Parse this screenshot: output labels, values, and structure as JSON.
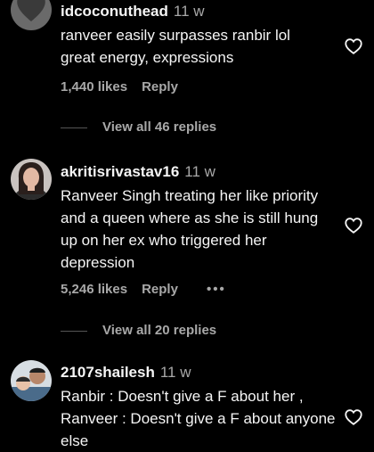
{
  "comments": [
    {
      "username": "idcoconuthead",
      "time": "11 w",
      "text": "ranveer easily surpasses ranbir lol great energy, expressions",
      "likes": "1,440 likes",
      "reply_label": "Reply",
      "view_replies": "View all 46 replies"
    },
    {
      "username": "akritisrivastav16",
      "time": "11 w",
      "text": "Ranveer Singh treating her like priority and a queen where as she is still hung up on her ex who triggered her depression",
      "likes": "5,246 likes",
      "reply_label": "Reply",
      "more_label": "•••",
      "view_replies": "View all 20 replies"
    },
    {
      "username": "2107shailesh",
      "time": "11 w",
      "text": "Ranbir : Doesn't give a F about her , Ranveer : Doesn't give a F about anyone else"
    }
  ],
  "colors": {
    "background": "#000000",
    "primary_text": "#f5f5f5",
    "secondary_text": "#a8a8a8"
  },
  "icons": {
    "like": "heart-outline-icon"
  }
}
